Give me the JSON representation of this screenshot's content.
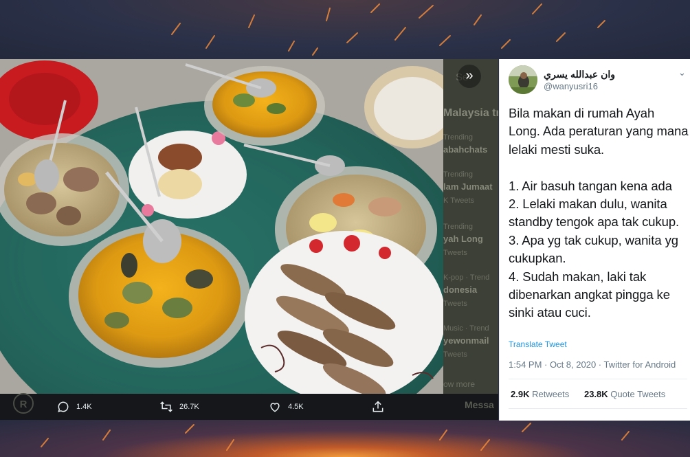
{
  "tweet": {
    "display_name": "وان عبدالله يسري",
    "handle": "@wanyusri16",
    "text": "Bila makan di rumah Ayah Long. Ada peraturan yang mana lelaki mesti suka.\n\n1. Air basuh tangan kena ada\n2. Lelaki makan dulu, wanita standby tengok apa tak cukup.\n3. Apa yg tak cukup, wanita yg cukupkan.\n4. Sudah makan, laki tak dibenarkan angkat pingga ke sinki atau cuci.",
    "translate_label": "Translate Tweet",
    "timestamp": "1:54 PM · Oct 8, 2020 · Twitter for Android",
    "retweets_count": "2.9K",
    "retweets_label": "Retweets",
    "quote_count": "23.8K",
    "quote_label": "Quote Tweets"
  },
  "media_actions": {
    "reply_count": "1.4K",
    "retweet_count": "26.7K",
    "like_count": "4.5K"
  },
  "background_timeline": {
    "search_fragment": "Se",
    "trends_heading": "Malaysia tr",
    "trends": [
      {
        "context": "Trending",
        "name": "abahchats",
        "tweets": ""
      },
      {
        "context": "Trending",
        "name": "lam Jumaat",
        "tweets": "K Tweets"
      },
      {
        "context": "Trending",
        "name": "yah Long",
        "tweets": "Tweets"
      },
      {
        "context": "Music · Trend",
        "name": "yewonmail",
        "tweets": "Tweets"
      }
    ],
    "trend_extra": [
      {
        "context": "K-pop · Trend",
        "name": "donesia",
        "tweets": "Tweets"
      }
    ],
    "show_more": "ow more",
    "messages": "Messa"
  },
  "watermark": "R",
  "colors": {
    "link_blue": "#1b95e0",
    "text_primary": "#14171a",
    "text_secondary": "#657786"
  }
}
